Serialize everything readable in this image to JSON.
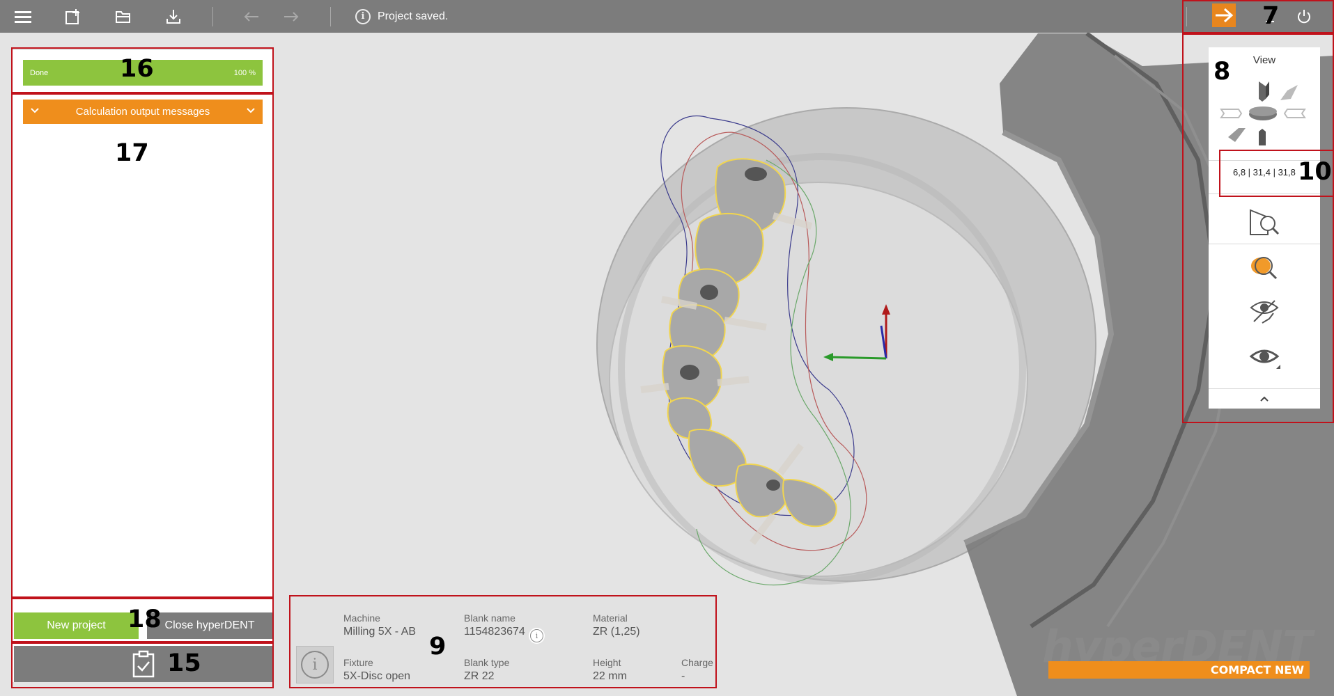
{
  "toolbar": {
    "status_message": "Project saved.",
    "icons": [
      "menu-icon",
      "new-project-icon",
      "open-folder-icon",
      "save-download-icon",
      "undo-arrow-icon",
      "redo-arrow-icon",
      "info-icon",
      "export-arrow-icon",
      "minimize-icon",
      "power-icon"
    ]
  },
  "progress": {
    "label": "Done",
    "percent_text": "100 %",
    "value": 1.0
  },
  "calc_panel": {
    "header": "Calculation output messages"
  },
  "actions": {
    "new_project": "New project",
    "close_app": "Close hyperDENT"
  },
  "info_panel": {
    "machine_label": "Machine",
    "machine_value": "Milling 5X - AB",
    "blank_name_label": "Blank name",
    "blank_name_value": "1154823674",
    "material_label": "Material",
    "material_value": "ZR (1,25)",
    "fixture_label": "Fixture",
    "fixture_value": "5X-Disc open",
    "blank_type_label": "Blank type",
    "blank_type_value": "ZR 22",
    "height_label": "Height",
    "height_value": "22 mm",
    "charge_label": "Charge",
    "charge_value": "-"
  },
  "view_panel": {
    "title": "View",
    "coordinates": "6,8  | 31,4 | 31,8",
    "icons": [
      "view-top-icon",
      "view-front-iso-icon",
      "view-left-icon",
      "view-right-icon",
      "view-center-disc-icon",
      "view-back-iso-icon",
      "view-bottom-icon",
      "zoom-fit-icon",
      "zoom-selection-icon",
      "visibility-toggle-icon",
      "eye-icon",
      "collapse-chevron-icon"
    ]
  },
  "annotations": {
    "a7": "7",
    "a8": "8",
    "a9": "9",
    "a10": "10",
    "a15": "15",
    "a16": "16",
    "a17": "17",
    "a18": "18"
  },
  "logo": {
    "name": "hyperDENT",
    "edition": "COMPACT NEW"
  },
  "colors": {
    "toolbar": "#7c7c7c",
    "accent_orange": "#ef8e1c",
    "accent_green": "#8dc43e",
    "annotation_red": "#c0121b"
  }
}
